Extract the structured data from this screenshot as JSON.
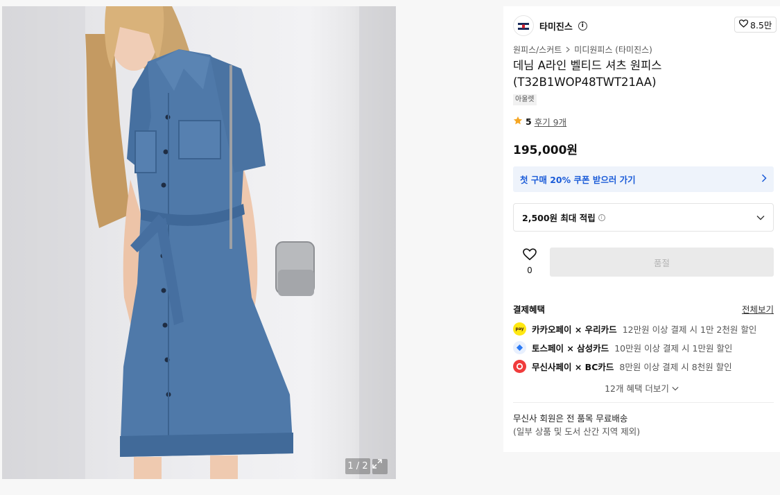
{
  "gallery": {
    "counter": "1 / 2"
  },
  "brand": {
    "name": "타미진스",
    "info": "i",
    "likes": "8.5만"
  },
  "breadcrumb": {
    "category": "원피스/스커트",
    "sub_category": "미디원피스 (타미진스)"
  },
  "product": {
    "title": "데님 A라인 벨티드 셔츠 원피스 (T32B1WOP48TWT21AA)",
    "tag": "아울렛",
    "rating": "5",
    "reviews": "후기 9개",
    "price": "195,000원"
  },
  "coupon": {
    "label": "첫 구매 20% 쿠폰 받으러 가기"
  },
  "points": {
    "label": "2,500원 최대 적립"
  },
  "actions": {
    "wish_count": "0",
    "soldout_label": "품절"
  },
  "benefits": {
    "title": "결제혜택",
    "view_all": "전체보기",
    "items": [
      {
        "icon": "kakaopay-icon",
        "main": "카카오페이 × 우리카드",
        "desc": "12만원 이상 결제 시 1만 2천원 할인",
        "color": "#ffe812"
      },
      {
        "icon": "tosspay-icon",
        "main": "토스페이 × 삼성카드",
        "desc": "10만원 이상 결제 시 1만원 할인",
        "color": "#2b7af5"
      },
      {
        "icon": "musinsapay-icon",
        "main": "무신사페이 × BC카드",
        "desc": "8만원 이상 결제 시 8천원 할인",
        "color": "#f03c3c"
      }
    ],
    "more": "12개 혜택 더보기"
  },
  "shipping": {
    "line1": "무신사 회원은 전 품목 무료배송",
    "line2": "(일부 상품 및 도서 산간 지역 제외)"
  },
  "colors": {
    "coupon_text": "#1a5bd8",
    "coupon_bg": "#eef3fb",
    "star": "#f5a623"
  }
}
